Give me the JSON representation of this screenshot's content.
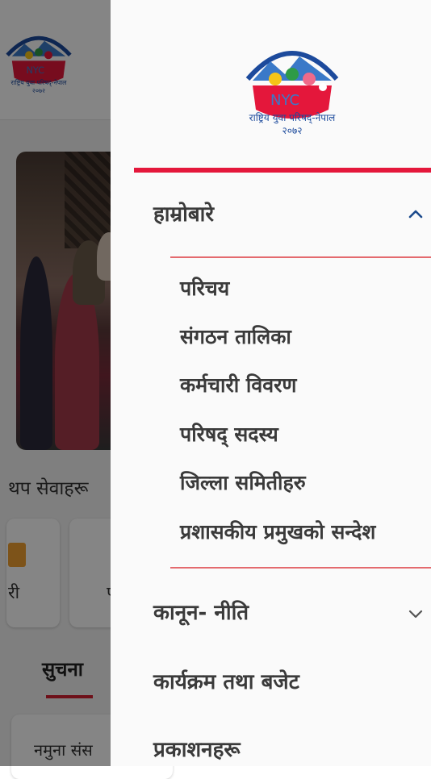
{
  "colors": {
    "accent_red": "#e4173b",
    "divider_red": "#e46a6e",
    "chevron_blue": "#1c4a8c",
    "text_dark": "#3a3a3a"
  },
  "logo": {
    "abbr": "NYC",
    "line1": "राष्ट्रिय युवा परिषद्-नेपाल",
    "line2": "२०७२"
  },
  "background": {
    "section_title": "थप सेवाहरू",
    "card1_label": "री",
    "card2_label": "प",
    "notice_tab": "सुचना",
    "notice_card_text": "नमुना संस"
  },
  "drawer": {
    "menu": [
      {
        "label": "हाम्रोबारे",
        "icon": "chevron-up-icon",
        "expanded": true,
        "children": [
          "परिचय",
          "संगठन तालिका",
          "कर्मचारी विवरण",
          "परिषद् सदस्य",
          "जिल्ला समितीहरु",
          "प्रशासकीय प्रमुखको सन्देश"
        ]
      },
      {
        "label": "कानून- नीति",
        "icon": "chevron-down-icon",
        "expanded": false
      },
      {
        "label": "कार्यक्रम तथा बजेट"
      },
      {
        "label": "प्रकाशनहरू"
      }
    ]
  }
}
